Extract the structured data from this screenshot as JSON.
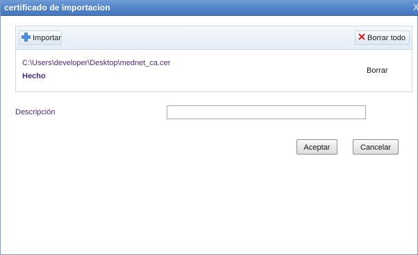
{
  "window": {
    "title": "certificado de importacion",
    "close_glyph": "X"
  },
  "toolbar": {
    "import_label": "Importar",
    "import_icon": "plus-icon",
    "clear_all_label": "Borrar todo",
    "clear_all_icon": "x-icon"
  },
  "file_list": [
    {
      "path": "C:\\Users\\developer\\Desktop\\mednet_ca.cer",
      "status": "Hecho",
      "delete_label": "Borrar"
    }
  ],
  "description": {
    "label": "Descripción",
    "value": ""
  },
  "buttons": {
    "accept_label": "Aceptar",
    "cancel_label": "Cancelar"
  },
  "colors": {
    "title_bar": "#5283c8",
    "accent_text": "#4b2a7a",
    "clear_icon": "#d42020",
    "import_icon": "#3a7fd6"
  }
}
